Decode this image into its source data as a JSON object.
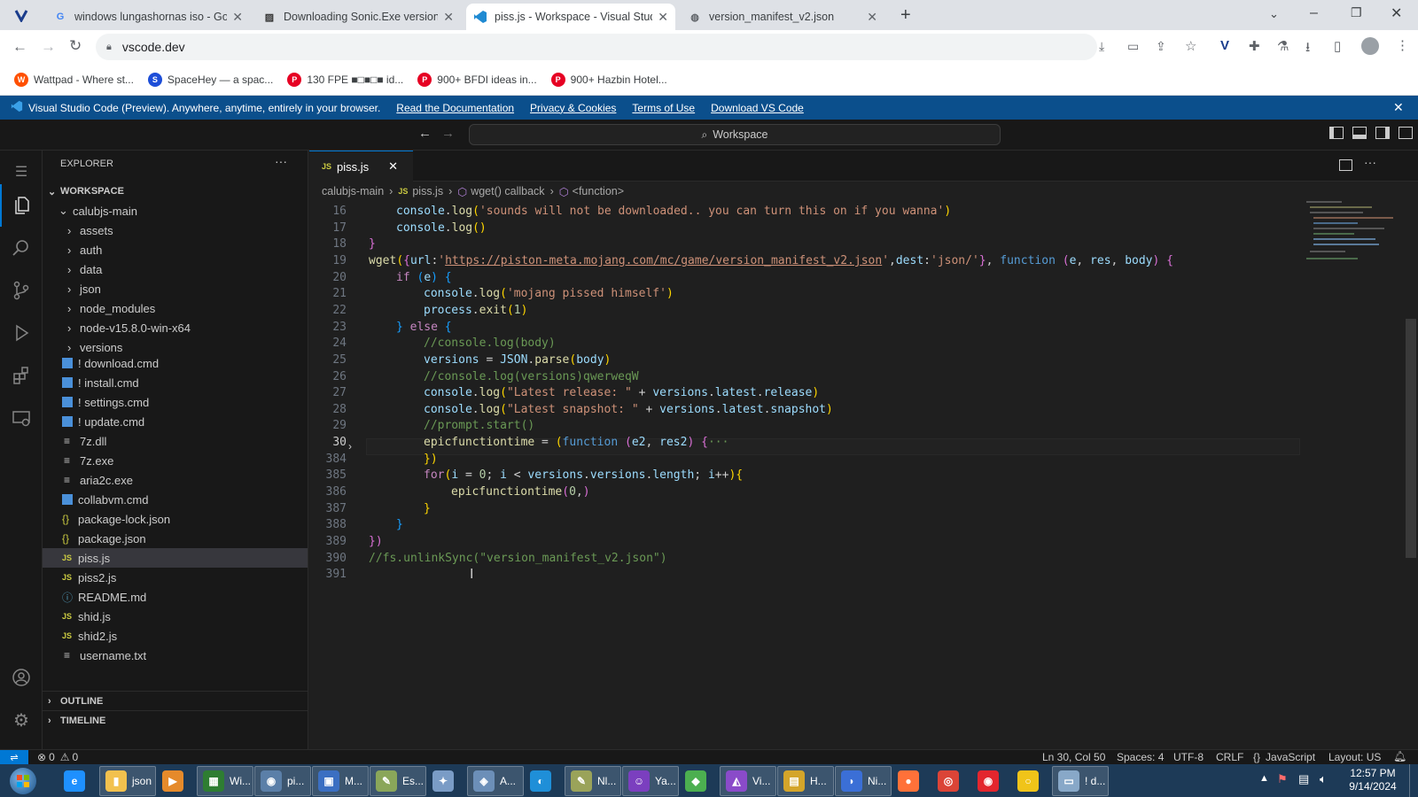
{
  "browser": {
    "tabs": [
      {
        "title": "windows lungashornas iso - Go",
        "icon": "google-icon"
      },
      {
        "title": "Downloading Sonic.Exe version",
        "icon": "page-icon"
      },
      {
        "title": "piss.js - Workspace - Visual Stud",
        "icon": "vscode-icon",
        "active": true
      },
      {
        "title": "version_manifest_v2.json",
        "icon": "globe-icon"
      }
    ],
    "url": "vscode.dev",
    "bookmarks": [
      {
        "label": "Wattpad - Where st...",
        "color": "#ff5000",
        "icon": "W"
      },
      {
        "label": "SpaceHey — a spac...",
        "color": "#1d4ed8",
        "icon": "S"
      },
      {
        "label": "130 FPE ■□■□■ id...",
        "color": "#e60023",
        "icon": "P"
      },
      {
        "label": "900+ BFDI ideas in...",
        "color": "#e60023",
        "icon": "P"
      },
      {
        "label": "900+ Hazbin Hotel...",
        "color": "#e60023",
        "icon": "P"
      }
    ]
  },
  "banner": {
    "text": "Visual Studio Code (Preview). Anywhere, anytime, entirely in your browser.",
    "links": [
      "Read the Documentation",
      "Privacy & Cookies",
      "Terms of Use",
      "Download VS Code"
    ]
  },
  "command_center": {
    "label": "Workspace"
  },
  "explorer": {
    "title": "EXPLORER",
    "workspace": "WORKSPACE",
    "root": "calubjs-main",
    "folders": [
      "assets",
      "auth",
      "data",
      "json",
      "node_modules",
      "node-v15.8.0-win-x64",
      "versions"
    ],
    "files": [
      {
        "name": "! download.cmd",
        "icon": "cmd-icon"
      },
      {
        "name": "! install.cmd",
        "icon": "cmd-icon"
      },
      {
        "name": "! settings.cmd",
        "icon": "cmd-icon"
      },
      {
        "name": "! update.cmd",
        "icon": "cmd-icon"
      },
      {
        "name": "7z.dll",
        "icon": "file-lines-icon"
      },
      {
        "name": "7z.exe",
        "icon": "file-lines-icon"
      },
      {
        "name": "aria2c.exe",
        "icon": "file-lines-icon"
      },
      {
        "name": "collabvm.cmd",
        "icon": "cmd-icon"
      },
      {
        "name": "package-lock.json",
        "icon": "json-icon"
      },
      {
        "name": "package.json",
        "icon": "json-icon"
      },
      {
        "name": "piss.js",
        "icon": "js-icon",
        "selected": true
      },
      {
        "name": "piss2.js",
        "icon": "js-icon"
      },
      {
        "name": "README.md",
        "icon": "info-icon"
      },
      {
        "name": "shid.js",
        "icon": "js-icon"
      },
      {
        "name": "shid2.js",
        "icon": "js-icon"
      },
      {
        "name": "username.txt",
        "icon": "file-lines-icon"
      }
    ],
    "outline": "OUTLINE",
    "timeline": "TIMELINE"
  },
  "editor": {
    "tab": "piss.js",
    "breadcrumbs": [
      "calubjs-main",
      "piss.js",
      "wget() callback",
      "<function>"
    ],
    "current_line": "30",
    "lines": [
      {
        "n": "16",
        "ind": 1,
        "t": [
          [
            "console",
            "v"
          ],
          [
            ".",
            ""
          ],
          [
            "log",
            "f"
          ],
          [
            "(",
            "p1"
          ],
          [
            "'sounds will not be downloaded.. you can turn this on if you wanna'",
            "s"
          ],
          [
            ")",
            "p1"
          ]
        ]
      },
      {
        "n": "17",
        "ind": 1,
        "t": [
          [
            "console",
            "v"
          ],
          [
            ".",
            ""
          ],
          [
            "log",
            "f"
          ],
          [
            "()",
            "p1"
          ]
        ]
      },
      {
        "n": "18",
        "ind": 0,
        "t": [
          [
            "}",
            "p2"
          ]
        ]
      },
      {
        "n": "19",
        "ind": 0,
        "t": [
          [
            "wget",
            "f"
          ],
          [
            "(",
            "p1"
          ],
          [
            "{",
            "p2"
          ],
          [
            "url",
            "v"
          ],
          [
            ":",
            ""
          ],
          [
            "'",
            "s"
          ],
          [
            "https://piston-meta.mojang.com/mc/game/version_manifest_v2.json",
            "su"
          ],
          [
            "'",
            "s"
          ],
          [
            ",",
            ""
          ],
          [
            "dest",
            "v"
          ],
          [
            ":",
            ""
          ],
          [
            "'json/'",
            "s"
          ],
          [
            "}",
            "p2"
          ],
          [
            ", ",
            ""
          ],
          [
            "function",
            "k"
          ],
          [
            " ",
            ""
          ],
          [
            "(",
            "p2"
          ],
          [
            "e",
            "v"
          ],
          [
            ", ",
            ""
          ],
          [
            "res",
            "v"
          ],
          [
            ", ",
            ""
          ],
          [
            "body",
            "v"
          ],
          [
            ")",
            "p2"
          ],
          [
            " ",
            ""
          ],
          [
            "{",
            "p2"
          ]
        ]
      },
      {
        "n": "20",
        "ind": 1,
        "t": [
          [
            "if",
            "cl"
          ],
          [
            " ",
            ""
          ],
          [
            "(",
            "p3"
          ],
          [
            "e",
            "v"
          ],
          [
            ")",
            "p3"
          ],
          [
            " ",
            ""
          ],
          [
            "{",
            "p3"
          ]
        ]
      },
      {
        "n": "21",
        "ind": 2,
        "t": [
          [
            "console",
            "v"
          ],
          [
            ".",
            ""
          ],
          [
            "log",
            "f"
          ],
          [
            "(",
            "p1"
          ],
          [
            "'mojang pissed himself'",
            "s"
          ],
          [
            ")",
            "p1"
          ]
        ]
      },
      {
        "n": "22",
        "ind": 2,
        "t": [
          [
            "process",
            "v"
          ],
          [
            ".",
            ""
          ],
          [
            "exit",
            "f"
          ],
          [
            "(",
            "p1"
          ],
          [
            "1",
            "n"
          ],
          [
            ")",
            "p1"
          ]
        ]
      },
      {
        "n": "23",
        "ind": 1,
        "t": [
          [
            "}",
            "p3"
          ],
          [
            " ",
            ""
          ],
          [
            "else",
            "cl"
          ],
          [
            " ",
            ""
          ],
          [
            "{",
            "p3"
          ]
        ]
      },
      {
        "n": "24",
        "ind": 2,
        "t": [
          [
            "//console.log(body)",
            "c"
          ]
        ]
      },
      {
        "n": "25",
        "ind": 2,
        "t": [
          [
            "versions",
            "v"
          ],
          [
            " = ",
            ""
          ],
          [
            "JSON",
            "v"
          ],
          [
            ".",
            ""
          ],
          [
            "parse",
            "f"
          ],
          [
            "(",
            "p1"
          ],
          [
            "body",
            "v"
          ],
          [
            ")",
            "p1"
          ]
        ]
      },
      {
        "n": "26",
        "ind": 2,
        "t": [
          [
            "//console.log(versions)qwerweqW",
            "c"
          ]
        ]
      },
      {
        "n": "27",
        "ind": 2,
        "t": [
          [
            "console",
            "v"
          ],
          [
            ".",
            ""
          ],
          [
            "log",
            "f"
          ],
          [
            "(",
            "p1"
          ],
          [
            "\"Latest release: \"",
            "s"
          ],
          [
            " + ",
            ""
          ],
          [
            "versions",
            "v"
          ],
          [
            ".",
            ""
          ],
          [
            "latest",
            "v"
          ],
          [
            ".",
            ""
          ],
          [
            "release",
            "v"
          ],
          [
            ")",
            "p1"
          ]
        ]
      },
      {
        "n": "28",
        "ind": 2,
        "t": [
          [
            "console",
            "v"
          ],
          [
            ".",
            ""
          ],
          [
            "log",
            "f"
          ],
          [
            "(",
            "p1"
          ],
          [
            "\"Latest snapshot: \"",
            "s"
          ],
          [
            " + ",
            ""
          ],
          [
            "versions",
            "v"
          ],
          [
            ".",
            ""
          ],
          [
            "latest",
            "v"
          ],
          [
            ".",
            ""
          ],
          [
            "snapshot",
            "v"
          ],
          [
            ")",
            "p1"
          ]
        ]
      },
      {
        "n": "29",
        "ind": 2,
        "t": [
          [
            "//prompt.start()",
            "c"
          ]
        ]
      },
      {
        "n": "30",
        "ind": 2,
        "t": [
          [
            "epicfunctiontime",
            "f"
          ],
          [
            " = ",
            ""
          ],
          [
            "(",
            "p1"
          ],
          [
            "function",
            "k"
          ],
          [
            " ",
            ""
          ],
          [
            "(",
            "p2"
          ],
          [
            "e2",
            "v"
          ],
          [
            ", ",
            ""
          ],
          [
            "res2",
            "v"
          ],
          [
            ")",
            "p2"
          ],
          [
            " ",
            ""
          ],
          [
            "{",
            "p2"
          ],
          [
            "···",
            "c"
          ]
        ]
      },
      {
        "n": "384",
        "ind": 2,
        "t": [
          [
            "})",
            "p1"
          ]
        ]
      },
      {
        "n": "385",
        "ind": 2,
        "t": [
          [
            "for",
            "cl"
          ],
          [
            "(",
            "p1"
          ],
          [
            "i",
            "v"
          ],
          [
            " = ",
            ""
          ],
          [
            "0",
            "n"
          ],
          [
            "; ",
            ""
          ],
          [
            "i",
            "v"
          ],
          [
            " < ",
            ""
          ],
          [
            "versions",
            "v"
          ],
          [
            ".",
            ""
          ],
          [
            "versions",
            "v"
          ],
          [
            ".",
            ""
          ],
          [
            "length",
            "v"
          ],
          [
            "; ",
            ""
          ],
          [
            "i",
            "v"
          ],
          [
            "++",
            ""
          ],
          [
            ")",
            "p1"
          ],
          [
            "{",
            "p1"
          ]
        ]
      },
      {
        "n": "386",
        "ind": 3,
        "t": [
          [
            "epicfunctiontime",
            "f"
          ],
          [
            "(",
            "p2"
          ],
          [
            "0",
            "n"
          ],
          [
            ",",
            ""
          ],
          [
            ")",
            "p2"
          ]
        ]
      },
      {
        "n": "387",
        "ind": 2,
        "t": [
          [
            "}",
            "p1"
          ]
        ]
      },
      {
        "n": "388",
        "ind": 1,
        "t": [
          [
            "}",
            "p3"
          ]
        ]
      },
      {
        "n": "389",
        "ind": 0,
        "t": [
          [
            "})",
            "p2"
          ]
        ]
      },
      {
        "n": "390",
        "ind": 0,
        "t": [
          [
            "//fs.unlinkSync(\"version_manifest_v2.json\")",
            "c"
          ]
        ]
      },
      {
        "n": "391",
        "ind": 0,
        "t": []
      }
    ]
  },
  "status": {
    "problems": "0",
    "warnings": "0",
    "position": "Ln 30, Col 50",
    "spaces": "Spaces: 4",
    "encoding": "UTF-8",
    "eol": "CRLF",
    "language": "JavaScript",
    "layout": "Layout: US"
  },
  "taskbar": {
    "items": [
      {
        "label": "json",
        "color": "#f2c14e"
      },
      {
        "label": "",
        "color": "#e58a2b"
      },
      {
        "label": "Wi...",
        "color": "#2e7d32"
      },
      {
        "label": "pi...",
        "color": "#5b7fa8"
      },
      {
        "label": "M...",
        "color": "#3b6fc2"
      },
      {
        "label": "Es...",
        "color": "#8aa65a"
      },
      {
        "label": "",
        "color": "#7a9cc6"
      },
      {
        "label": "A...",
        "color": "#6c8fb8"
      },
      {
        "label": "",
        "color": "#1f8fd8"
      },
      {
        "label": "Nl...",
        "color": "#9aa35a"
      },
      {
        "label": "Ya...",
        "color": "#7b3fbf"
      },
      {
        "label": "",
        "color": "#4caf50"
      },
      {
        "label": "Vi...",
        "color": "#8a4bc9"
      },
      {
        "label": "H...",
        "color": "#d4a52a"
      },
      {
        "label": "Ni...",
        "color": "#3b6fd6"
      },
      {
        "label": "",
        "color": "#ff7139"
      },
      {
        "label": "",
        "color": "#db4437"
      },
      {
        "label": "",
        "color": "#e3262e"
      },
      {
        "label": "",
        "color": "#f0c419"
      },
      {
        "label": "! d...",
        "color": "#88a8c8"
      }
    ],
    "time": "12:57 PM",
    "date": "9/14/2024"
  }
}
